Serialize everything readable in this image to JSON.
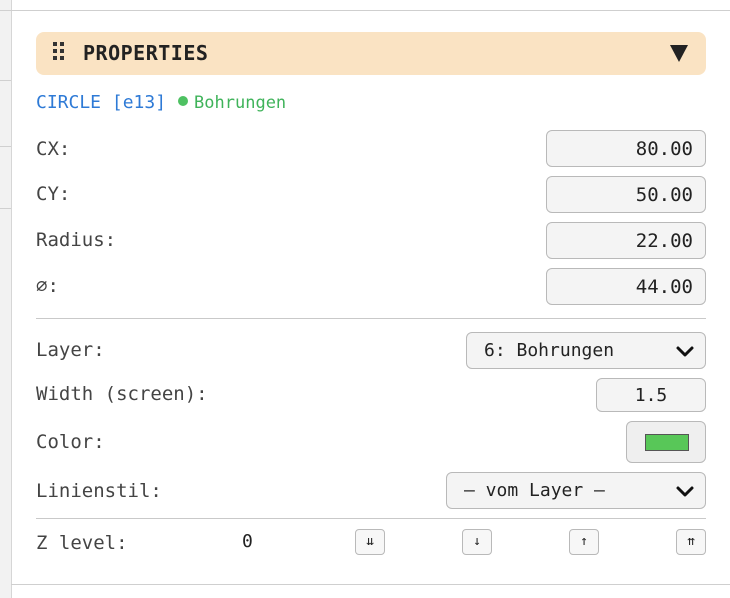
{
  "panel": {
    "title": "PROPERTIES"
  },
  "entity": {
    "type_label": "CIRCLE [e13]",
    "layer_name": "Bohrungen",
    "dot_color": "#4ec162"
  },
  "geometry": {
    "cx_label": "CX:",
    "cx_value": "80.00",
    "cy_label": "CY:",
    "cy_value": "50.00",
    "radius_label": "Radius:",
    "radius_value": "22.00",
    "diameter_label": "⌀:",
    "diameter_value": "44.00"
  },
  "style": {
    "layer_label": "Layer:",
    "layer_selected": "6: Bohrungen",
    "width_label": "Width (screen):",
    "width_value": "1.5",
    "color_label": "Color:",
    "color_value": "#58c758",
    "linestyle_label": "Linienstil:",
    "linestyle_selected": "— vom Layer —"
  },
  "z_level": {
    "label": "Z level:",
    "value": "0",
    "buttons": {
      "to_bottom": "⇊",
      "down": "↓",
      "up": "↑",
      "to_top": "⇈"
    }
  },
  "icons": {
    "grip": "grip-icon",
    "collapse": "triangle-down-icon",
    "chevron": "chevron-down-icon"
  }
}
